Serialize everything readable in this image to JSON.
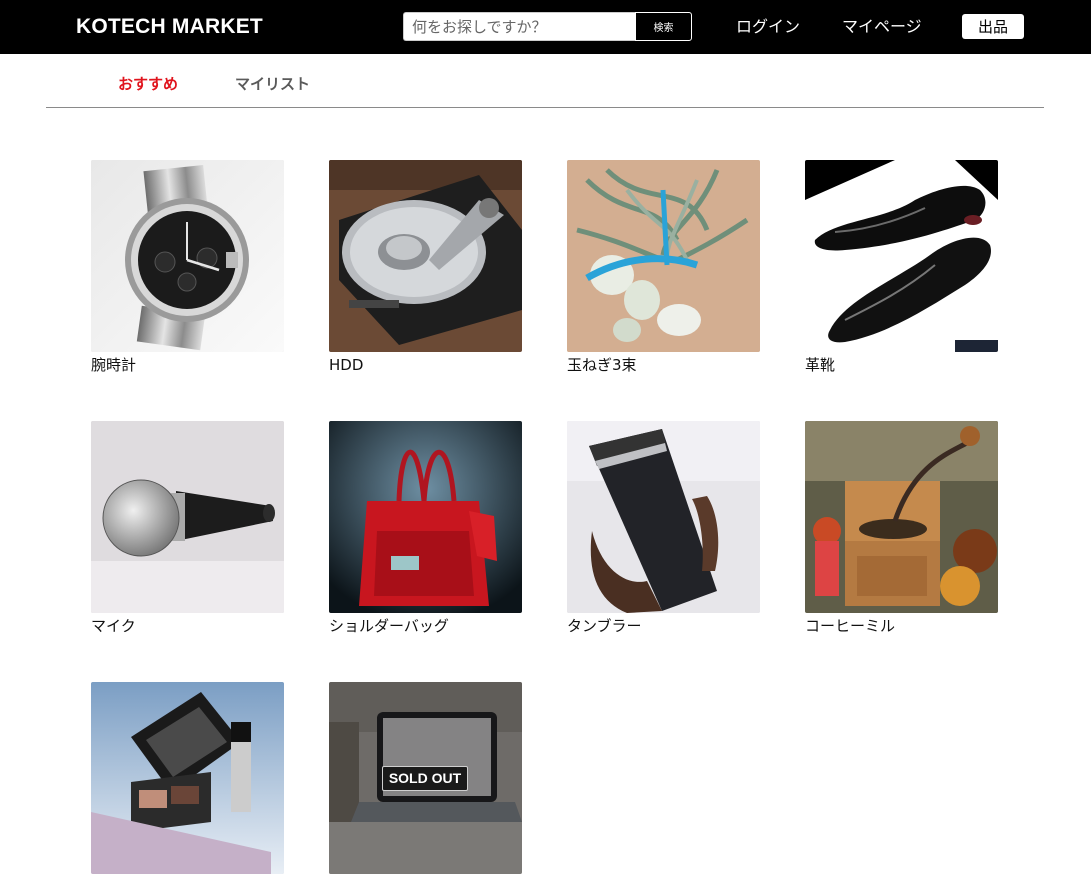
{
  "header": {
    "logo": "KOTECH MARKET",
    "search": {
      "placeholder": "何をお探しですか？",
      "value": "",
      "button_label": "検索"
    },
    "nav": {
      "login": "ログイン",
      "mypage": "マイページ",
      "sell": "出品"
    }
  },
  "tabs": [
    {
      "label": "おすすめ",
      "active": true
    },
    {
      "label": "マイリスト",
      "active": false
    }
  ],
  "colors": {
    "header_bg": "#000000",
    "active_tab": "#e0141d",
    "inactive_tab": "#5a5a5a"
  },
  "products": [
    {
      "name": "腕時計",
      "image": "wristwatch-photo",
      "sold_out": false
    },
    {
      "name": "HDD",
      "image": "hard-disk-drive-photo",
      "sold_out": false
    },
    {
      "name": "玉ねぎ3束",
      "image": "onion-bundle-photo",
      "sold_out": false
    },
    {
      "name": "革靴",
      "image": "leather-shoes-photo",
      "sold_out": false
    },
    {
      "name": "マイク",
      "image": "microphone-photo",
      "sold_out": false
    },
    {
      "name": "ショルダーバッグ",
      "image": "red-shoulder-bag-photo",
      "sold_out": false
    },
    {
      "name": "タンブラー",
      "image": "tumbler-photo",
      "sold_out": false
    },
    {
      "name": "コーヒーミル",
      "image": "coffee-mill-photo",
      "sold_out": false
    },
    {
      "name": "",
      "image": "makeup-set-photo",
      "sold_out": false
    },
    {
      "name": "",
      "image": "laptop-photo",
      "sold_out": true,
      "sold_out_label": "SOLD OUT"
    }
  ]
}
